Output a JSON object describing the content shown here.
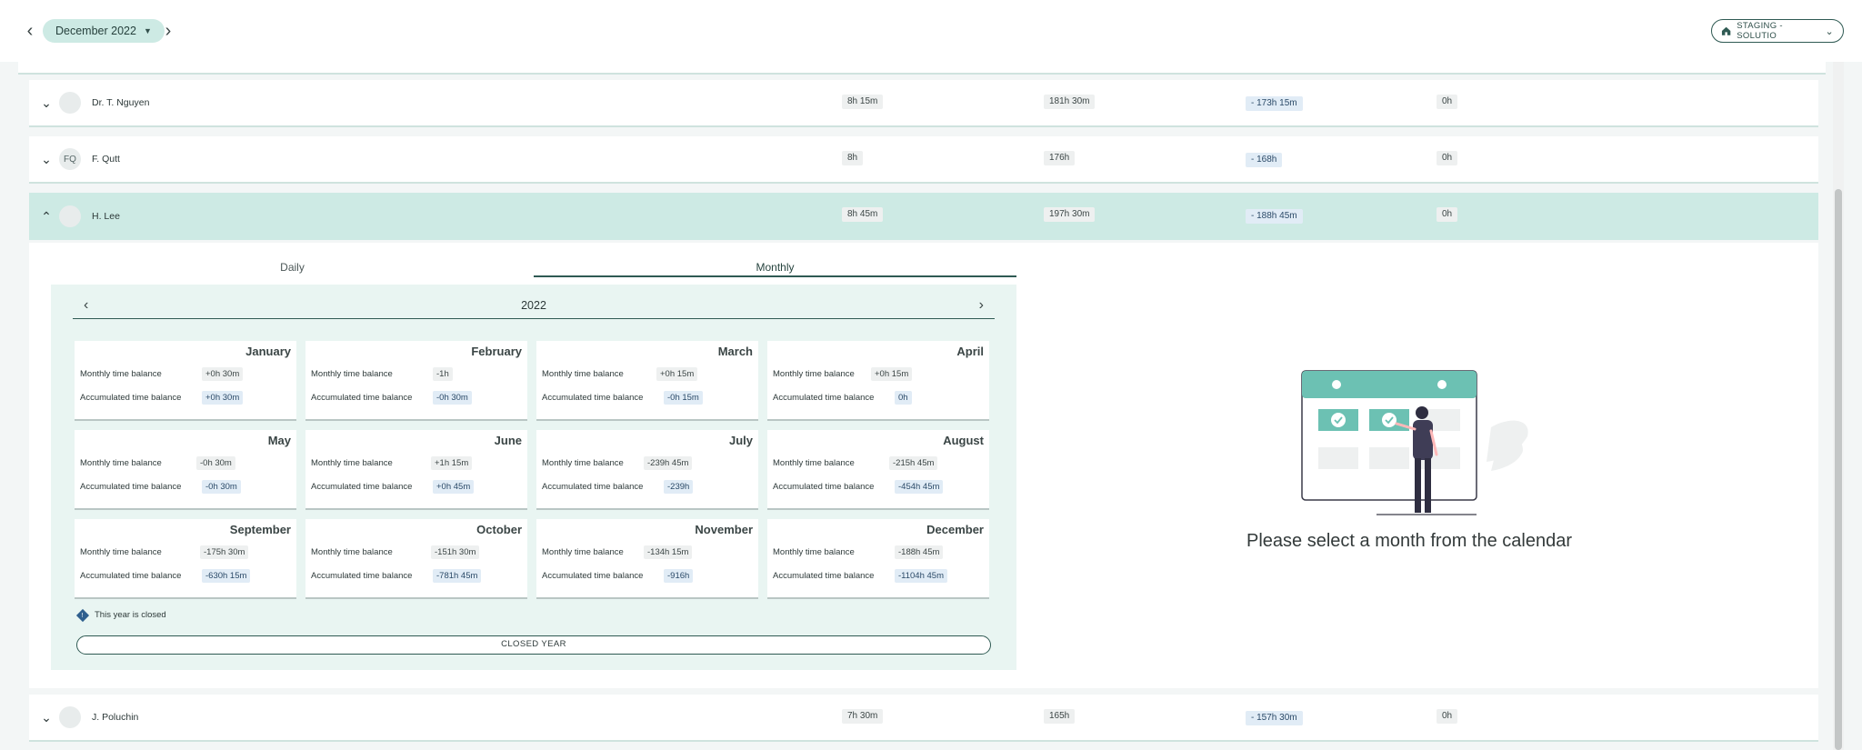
{
  "header": {
    "month_label": "December 2022",
    "environment_label": "STAGING - SOLUTIO"
  },
  "employees": [
    {
      "name": "Dr. T. Nguyen",
      "initials": "",
      "col1": "8h 15m",
      "col2": "181h 30m",
      "col3": "- 173h 15m",
      "col4": "0h",
      "toggle": "⌄"
    },
    {
      "name": "F. Qutt",
      "initials": "FQ",
      "col1": "8h",
      "col2": "176h",
      "col3": "- 168h",
      "col4": "0h",
      "toggle": "⌄"
    },
    {
      "name": "H. Lee",
      "initials": "",
      "col1": "8h 45m",
      "col2": "197h 30m",
      "col3": "- 188h 45m",
      "col4": "0h",
      "toggle": "⌃"
    },
    {
      "name": "J. Poluchin",
      "initials": "",
      "col1": "7h 30m",
      "col2": "165h",
      "col3": "- 157h 30m",
      "col4": "0h",
      "toggle": "⌄"
    }
  ],
  "details": {
    "tabs": [
      {
        "label": "Daily"
      },
      {
        "label": "Monthly"
      }
    ],
    "year": "2022",
    "monthly_label": "Monthly time balance",
    "accumulated_label": "Accumulated time balance",
    "months": [
      {
        "name": "January",
        "monthly": "+0h 30m",
        "accumulated": "+0h 30m"
      },
      {
        "name": "February",
        "monthly": "-1h",
        "accumulated": "-0h 30m"
      },
      {
        "name": "March",
        "monthly": "+0h 15m",
        "accumulated": "-0h 15m"
      },
      {
        "name": "April",
        "monthly": "+0h 15m",
        "accumulated": "0h"
      },
      {
        "name": "May",
        "monthly": "-0h 30m",
        "accumulated": "-0h 30m"
      },
      {
        "name": "June",
        "monthly": "+1h 15m",
        "accumulated": "+0h 45m"
      },
      {
        "name": "July",
        "monthly": "-239h 45m",
        "accumulated": "-239h"
      },
      {
        "name": "August",
        "monthly": "-215h 45m",
        "accumulated": "-454h 45m"
      },
      {
        "name": "September",
        "monthly": "-175h 30m",
        "accumulated": "-630h 15m"
      },
      {
        "name": "October",
        "monthly": "-151h 30m",
        "accumulated": "-781h 45m"
      },
      {
        "name": "November",
        "monthly": "-134h 15m",
        "accumulated": "-916h"
      },
      {
        "name": "December",
        "monthly": "-188h 45m",
        "accumulated": "-1104h 45m"
      }
    ],
    "closed_note": "This year is closed",
    "closed_button": "CLOSED YEAR",
    "empty_message": "Please select a month from the calendar"
  },
  "colors": {
    "accent": "#6cc1b3",
    "accent_dark": "#2f5a53",
    "expanded_row": "#cdeae4",
    "calendar_bg": "#e9f5f2"
  }
}
